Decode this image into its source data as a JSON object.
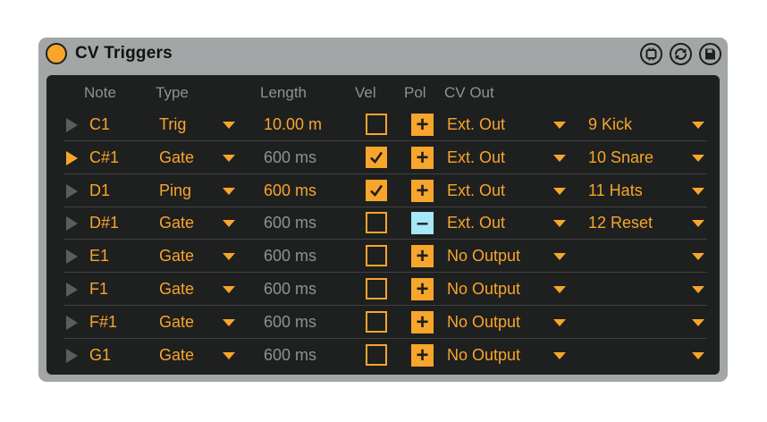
{
  "title": "CV Triggers",
  "headers": {
    "note": "Note",
    "type": "Type",
    "length": "Length",
    "vel": "Vel",
    "pol": "Pol",
    "cv_out": "CV Out"
  },
  "icons": {
    "power": "power-toggle-icon",
    "hardware": "hardware-icon",
    "refresh": "refresh-icon",
    "save": "save-icon"
  },
  "colors": {
    "accent": "#f7a52c",
    "negative_polarity": "#a6e8f7",
    "panel": "#1e1f1f",
    "chrome": "#a3a6a6",
    "dim_text": "#8f9293"
  },
  "rows": [
    {
      "note": "C1",
      "type": "Trig",
      "length": "10.00 m",
      "length_active": true,
      "vel": false,
      "pol": "+",
      "out": "Ext. Out",
      "channel": "9 Kick",
      "playing": false
    },
    {
      "note": "C#1",
      "type": "Gate",
      "length": "600 ms",
      "length_active": false,
      "vel": true,
      "pol": "+",
      "out": "Ext. Out",
      "channel": "10 Snare",
      "playing": true
    },
    {
      "note": "D1",
      "type": "Ping",
      "length": "600 ms",
      "length_active": true,
      "vel": true,
      "pol": "+",
      "out": "Ext. Out",
      "channel": "11 Hats",
      "playing": false
    },
    {
      "note": "D#1",
      "type": "Gate",
      "length": "600 ms",
      "length_active": false,
      "vel": false,
      "pol": "–",
      "out": "Ext. Out",
      "channel": "12 Reset",
      "playing": false
    },
    {
      "note": "E1",
      "type": "Gate",
      "length": "600 ms",
      "length_active": false,
      "vel": false,
      "pol": "+",
      "out": "No Output",
      "channel": "",
      "playing": false
    },
    {
      "note": "F1",
      "type": "Gate",
      "length": "600 ms",
      "length_active": false,
      "vel": false,
      "pol": "+",
      "out": "No Output",
      "channel": "",
      "playing": false
    },
    {
      "note": "F#1",
      "type": "Gate",
      "length": "600 ms",
      "length_active": false,
      "vel": false,
      "pol": "+",
      "out": "No Output",
      "channel": "",
      "playing": false
    },
    {
      "note": "G1",
      "type": "Gate",
      "length": "600 ms",
      "length_active": false,
      "vel": false,
      "pol": "+",
      "out": "No Output",
      "channel": "",
      "playing": false
    }
  ]
}
